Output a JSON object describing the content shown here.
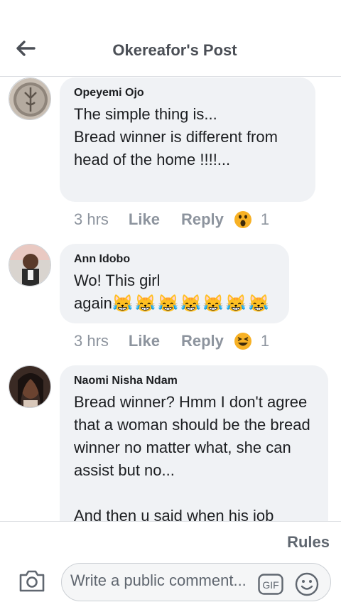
{
  "header": {
    "title": "Okereafor's Post",
    "back_icon": "arrow-left-icon"
  },
  "comments": [
    {
      "author": "Opeyemi Ojo",
      "text": "The simple thing is...\nBread winner is different from head of the home !!!!...",
      "time": "3 hrs",
      "like": "Like",
      "reply": "Reply",
      "reaction_icon": "wow-reaction-icon",
      "reaction_count": "1"
    },
    {
      "author": "Ann Idobo",
      "text": "Wo! This girl\nagain",
      "emojis": [
        "😹",
        "😹",
        "😹",
        "😹",
        "😹",
        "😹",
        "😹"
      ],
      "time": "3 hrs",
      "like": "Like",
      "reply": "Reply",
      "reaction_icon": "haha-reaction-icon",
      "reaction_count": "1"
    },
    {
      "author": "Naomi Nisha Ndam",
      "text": "Bread winner? Hmm I don't agree that a woman should be the bread winner no matter what, she can assist but no...\n\nAnd then u said when his job",
      "time": "",
      "like": "",
      "reply": ""
    }
  ],
  "footer": {
    "rules": "Rules",
    "composer_placeholder": "Write a public comment...",
    "gif_label": "GIF"
  },
  "colors": {
    "bubble": "#f0f2f5",
    "meta": "#8d949e",
    "title": "#4b4f56",
    "reaction_yellow": "#f7b125"
  }
}
